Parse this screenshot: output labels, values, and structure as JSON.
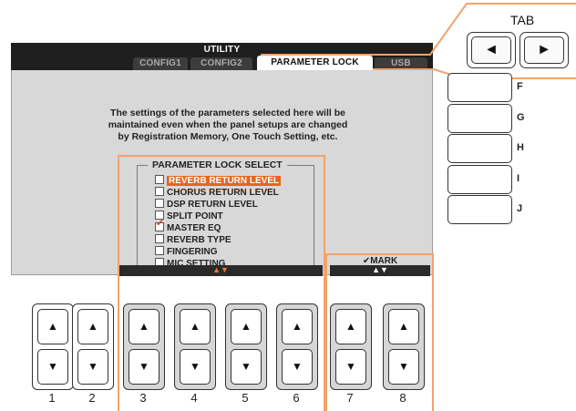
{
  "screen": {
    "title": "UTILITY",
    "tabs": [
      {
        "label": "CONFIG1",
        "active": false
      },
      {
        "label": "CONFIG2",
        "active": false
      },
      {
        "label": "PARAMETER LOCK",
        "active": true
      },
      {
        "label": "USB",
        "active": false
      }
    ],
    "description_lines": [
      "The settings of the parameters selected here will be",
      "maintained even when the panel setups are changed",
      "by Registration Memory, One Touch Setting, etc."
    ],
    "parameter_lock": {
      "header": "PARAMETER LOCK SELECT",
      "items": [
        {
          "label": "REVERB RETURN LEVEL",
          "checked": false,
          "highlighted": true
        },
        {
          "label": "CHORUS RETURN LEVEL",
          "checked": false,
          "highlighted": false
        },
        {
          "label": "DSP RETURN LEVEL",
          "checked": false,
          "highlighted": false
        },
        {
          "label": "SPLIT POINT",
          "checked": false,
          "highlighted": false
        },
        {
          "label": "MASTER EQ",
          "checked": true,
          "highlighted": false
        },
        {
          "label": "REVERB TYPE",
          "checked": false,
          "highlighted": false
        },
        {
          "label": "FINGERING",
          "checked": false,
          "highlighted": false
        },
        {
          "label": "MIC SETTING",
          "checked": false,
          "highlighted": false
        }
      ],
      "scroll_arrows": "▲▼"
    },
    "mark": {
      "label": "✔MARK",
      "arrows": "▲▼"
    }
  },
  "tab_buttons": {
    "label": "TAB",
    "left": "◄",
    "right": "►"
  },
  "side_buttons": [
    "F",
    "G",
    "H",
    "I",
    "J"
  ],
  "bottom_buttons": {
    "numbers": [
      "1",
      "2",
      "3",
      "4",
      "5",
      "6",
      "7",
      "8"
    ],
    "up": "▲",
    "down": "▼"
  },
  "colors": {
    "highlight": "#e5651f",
    "frame": "#f2a26a",
    "check": "#d4451a",
    "screen_bg": "#d8d8d8"
  }
}
